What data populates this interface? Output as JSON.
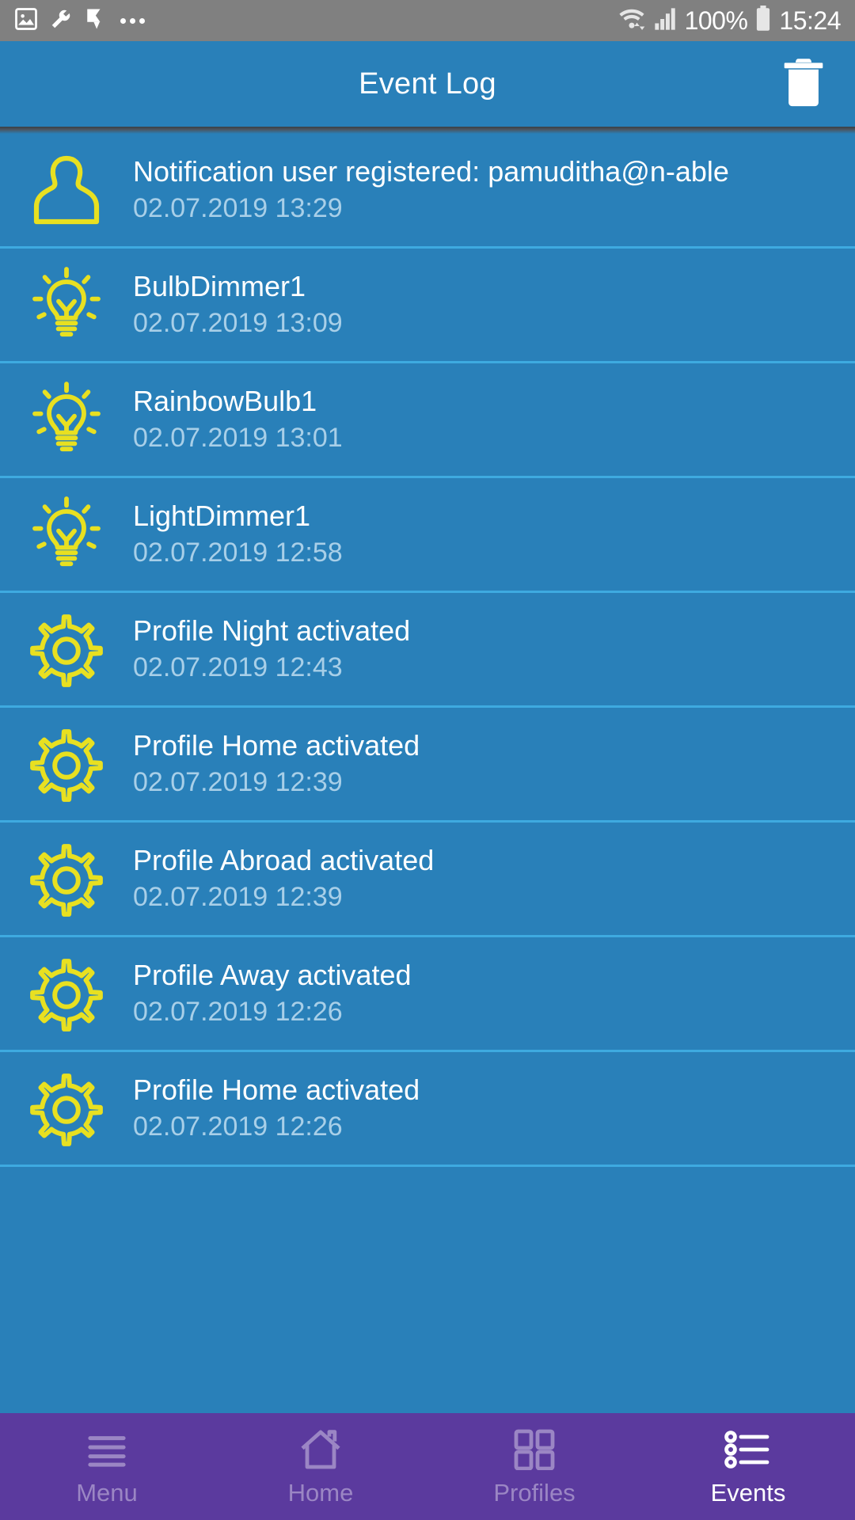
{
  "status_bar": {
    "left_icons": [
      "image-icon",
      "wrench-icon",
      "flag-icon",
      "more-dots-icon"
    ],
    "wifi_icon": "wifi-icon",
    "signal_icon": "cellular-signal-icon",
    "battery_percent": "100%",
    "battery_icon": "battery-full-icon",
    "clock": "15:24"
  },
  "header": {
    "title": "Event Log",
    "delete_icon": "trash-icon"
  },
  "colors": {
    "primary_blue": "#2980b9",
    "divider_blue": "#3eaae0",
    "accent_yellow": "#e8e021",
    "nav_purple": "#5b3a9e",
    "status_gray": "#808080",
    "timestamp_blue": "#a8cfe8"
  },
  "events": [
    {
      "icon": "person-icon",
      "title": "Notification user registered: pamuditha@n-able",
      "time": "02.07.2019 13:29"
    },
    {
      "icon": "lightbulb-icon",
      "title": "BulbDimmer1",
      "time": "02.07.2019 13:09"
    },
    {
      "icon": "lightbulb-icon",
      "title": "RainbowBulb1",
      "time": "02.07.2019 13:01"
    },
    {
      "icon": "lightbulb-icon",
      "title": "LightDimmer1",
      "time": "02.07.2019 12:58"
    },
    {
      "icon": "gear-icon",
      "title": "Profile Night activated",
      "time": "02.07.2019 12:43"
    },
    {
      "icon": "gear-icon",
      "title": "Profile Home activated",
      "time": "02.07.2019 12:39"
    },
    {
      "icon": "gear-icon",
      "title": "Profile Abroad activated",
      "time": "02.07.2019 12:39"
    },
    {
      "icon": "gear-icon",
      "title": "Profile Away activated",
      "time": "02.07.2019 12:26"
    },
    {
      "icon": "gear-icon",
      "title": "Profile Home activated",
      "time": "02.07.2019 12:26"
    }
  ],
  "bottom_nav": {
    "items": [
      {
        "label": "Menu",
        "icon": "hamburger-menu-icon",
        "active": false
      },
      {
        "label": "Home",
        "icon": "home-icon",
        "active": false
      },
      {
        "label": "Profiles",
        "icon": "grid-squares-icon",
        "active": false
      },
      {
        "label": "Events",
        "icon": "bullet-list-icon",
        "active": true
      }
    ]
  }
}
